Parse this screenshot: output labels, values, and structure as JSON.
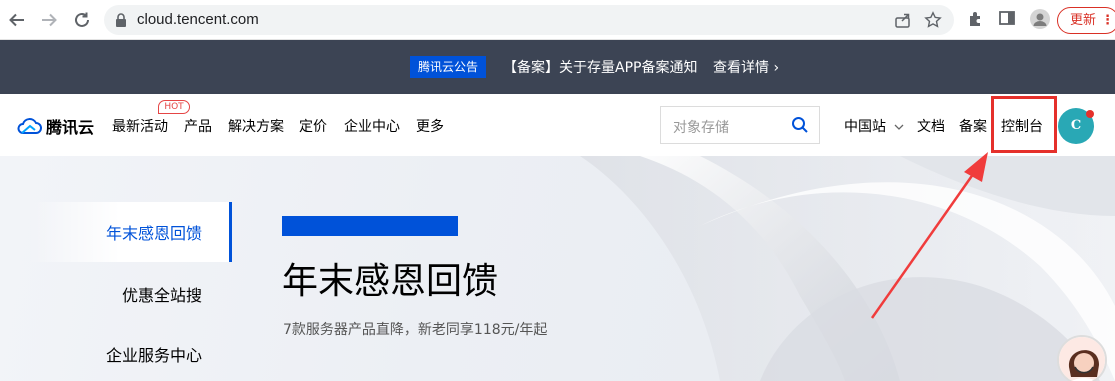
{
  "browser": {
    "url": "cloud.tencent.com",
    "update_label": "更新",
    "update_menu": "⋮"
  },
  "announcement": {
    "badge": "腾讯云公告",
    "text": "【备案】关于存量APP备案通知",
    "more": "查看详情 ›"
  },
  "nav": {
    "logo": "腾讯云",
    "hot_badge": "HOT",
    "items": [
      "最新活动",
      "产品",
      "解决方案",
      "定价",
      "企业中心",
      "更多"
    ],
    "search_placeholder": "对象存储",
    "region": "中国站",
    "docs": "文档",
    "beian": "备案",
    "console": "控制台",
    "avatar_letter": "C"
  },
  "hero": {
    "side_items": [
      "年末感恩回馈",
      "优惠全站搜",
      "企业服务中心"
    ],
    "title": "年末感恩回馈",
    "subtitle": "7款服务器产品直降，新老同享118元/年起"
  },
  "colors": {
    "brand_blue": "#0052d9",
    "announce_bg": "#3c4454",
    "highlight_red": "#e5302b",
    "avatar_teal": "#29a8b5"
  }
}
